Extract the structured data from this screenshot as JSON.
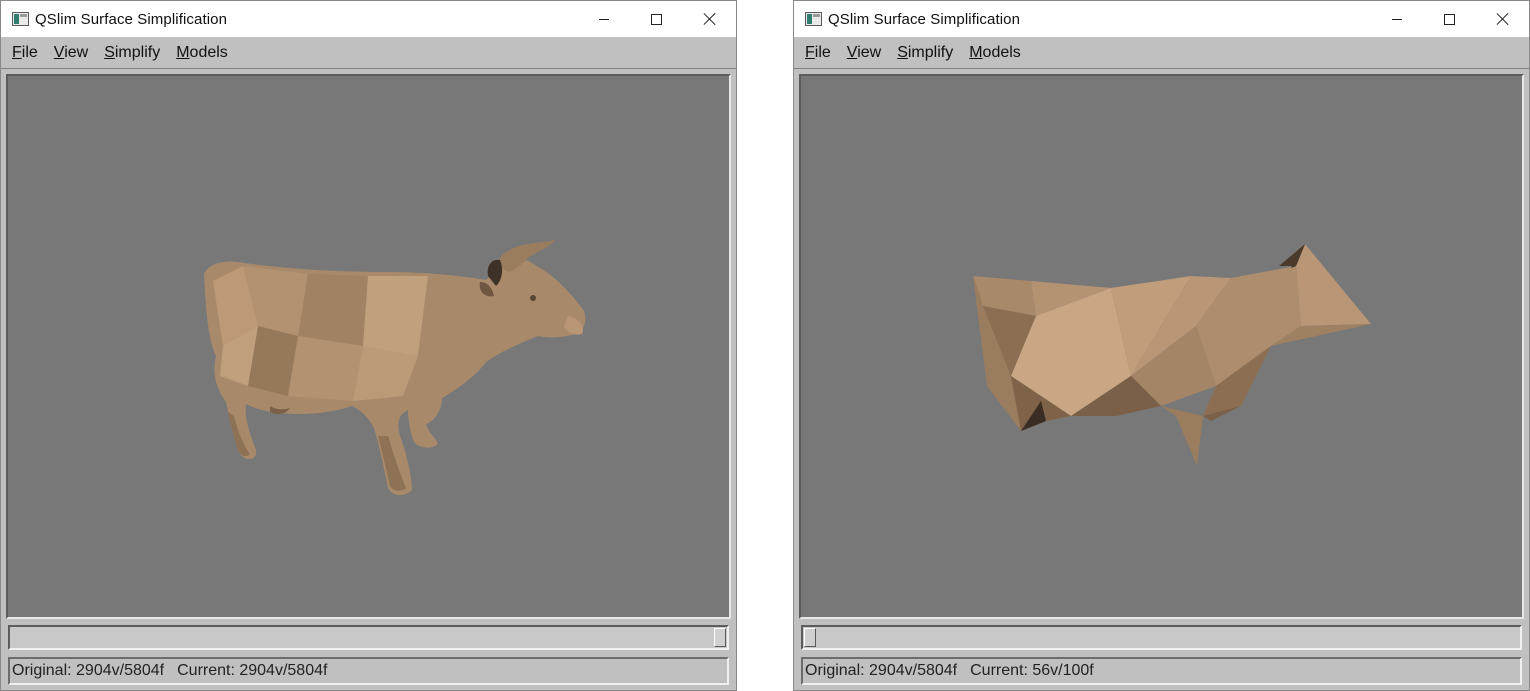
{
  "windows": [
    {
      "title": "QSlim Surface Simplification",
      "menu": [
        {
          "key": "F",
          "rest": "ile"
        },
        {
          "key": "V",
          "rest": "iew"
        },
        {
          "key": "S",
          "rest": "implify"
        },
        {
          "key": "M",
          "rest": "odels"
        }
      ],
      "model": "detailed cow mesh",
      "slider_fraction": 1.0,
      "status": {
        "original": "Original: 2904v/5804f",
        "current": "Current: 2904v/5804f"
      }
    },
    {
      "title": "QSlim Surface Simplification",
      "menu": [
        {
          "key": "F",
          "rest": "ile"
        },
        {
          "key": "V",
          "rest": "iew"
        },
        {
          "key": "S",
          "rest": "implify"
        },
        {
          "key": "M",
          "rest": "odels"
        }
      ],
      "model": "simplified cow mesh",
      "slider_fraction": 0.0,
      "status": {
        "original": "Original: 2904v/5804f",
        "current": "Current: 56v/100f"
      }
    }
  ],
  "colors": {
    "viewport_bg": "#787878",
    "mesh_base": "#a88a6a",
    "mesh_light": "#c7a583",
    "mesh_dark": "#6e5640"
  }
}
